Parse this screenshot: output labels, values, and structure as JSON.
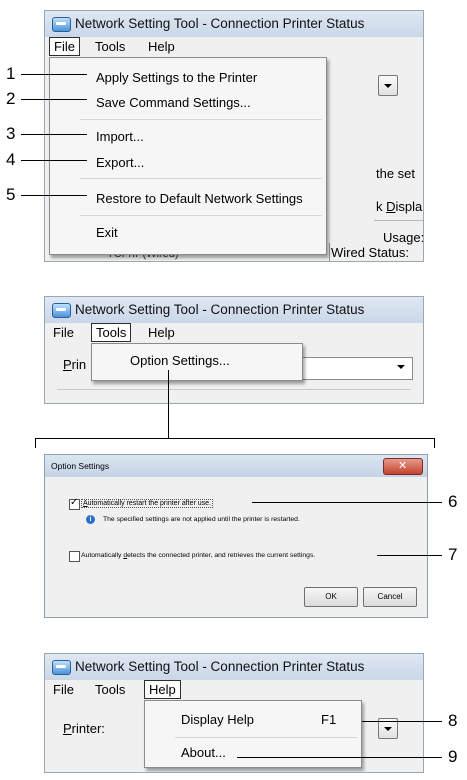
{
  "panel1": {
    "title": "Network Setting Tool - Connection Printer Status",
    "menu": {
      "file": "File",
      "tools": "Tools",
      "help": "Help"
    },
    "items": [
      {
        "number": "1",
        "label": "Apply Settings to the Printer"
      },
      {
        "number": "2",
        "label": "Save Command Settings..."
      },
      {
        "number": "3",
        "label": "Import..."
      },
      {
        "number": "4",
        "label": "Export..."
      },
      {
        "number": "5",
        "label": "Restore to Default Network Settings"
      },
      {
        "number": "",
        "label": "Exit"
      }
    ],
    "background_text": {
      "set": "the set",
      "display_prefix": "k ",
      "display_accel": "D",
      "display_rest": "ispla",
      "usage": "Usage:",
      "wired_status": "Wired Status:",
      "tree_item": "TCP/IP(Wired)"
    }
  },
  "panel2": {
    "title": "Network Setting Tool - Connection Printer Status",
    "menu": {
      "file": "File",
      "tools": "Tools",
      "help": "Help"
    },
    "item": "Option Settings...",
    "printer_label_accel": "P",
    "printer_label_rest": "rin"
  },
  "dialog": {
    "title": "Option Settings",
    "opt1_accel": "A",
    "opt1_rest": "utomatically restart the printer after use.",
    "opt1_number": "6",
    "info": "The specified settings are not applied until the printer is restarted.",
    "opt2_pre": "Automatically ",
    "opt2_accel": "d",
    "opt2_rest": "etects the connected printer, and retrieves the current settings.",
    "opt2_number": "7",
    "ok": "OK",
    "cancel": "Cancel"
  },
  "panel3": {
    "title": "Network Setting Tool - Connection Printer Status",
    "menu": {
      "file": "File",
      "tools": "Tools",
      "help": "Help"
    },
    "printer_label_accel": "P",
    "printer_label_rest": "rinter:",
    "items": [
      {
        "number": "8",
        "label": "Display Help",
        "shortcut": "F1"
      },
      {
        "number": "9",
        "label": "About...",
        "shortcut": ""
      }
    ]
  }
}
